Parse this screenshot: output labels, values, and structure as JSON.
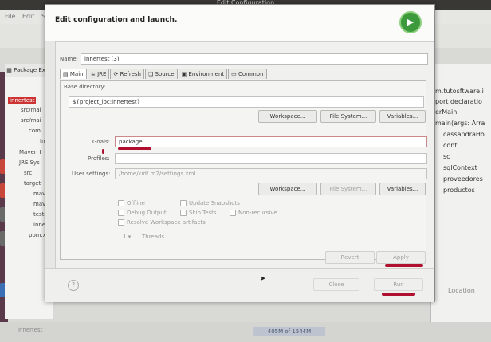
{
  "window_title": "Edit Configuration",
  "ide": {
    "menu": [
      "File",
      "Edit",
      "So"
    ],
    "package_explorer_tab": "Package Exp",
    "tree": [
      "innertest",
      "src/mai",
      "src/mai",
      "com.",
      "In",
      "Maven I",
      "JRE Sys",
      "src",
      "target",
      "mave",
      "mave",
      "test-",
      "inner",
      "pom.xn"
    ],
    "outline": [
      "m.tutosftware.i",
      "port declaratio",
      "erMain",
      "main(args: Arra",
      "cassandraHo",
      "conf",
      "sc",
      "sqlContext",
      "proveedores",
      "productos"
    ],
    "location_header": "Location",
    "status_left": "innertest",
    "heap": "405M of 1544M"
  },
  "dialog": {
    "header": "Edit configuration and launch.",
    "name_label": "Name:",
    "name_value": "innertest (3)",
    "tabs": [
      "Main",
      "JRE",
      "Refresh",
      "Source",
      "Environment",
      "Common"
    ],
    "base_dir_label": "Base directory:",
    "base_dir_value": "${project_loc:innertest}",
    "workspace_btn": "Workspace...",
    "filesystem_btn": "File System...",
    "variables_btn": "Variables...",
    "goals_label": "Goals:",
    "goals_value": "package",
    "profiles_label": "Profiles:",
    "profiles_value": "",
    "user_settings_label": "User settings:",
    "user_settings_value": "/home/kid/.m2/settings.xml",
    "checks": {
      "offline": "Offline",
      "update_snapshots": "Update Snapshots",
      "debug_output": "Debug Output",
      "skip_tests": "Skip Tests",
      "non_recursive": "Non-recursive",
      "resolve_workspace": "Resolve Workspace artifacts"
    },
    "threads_value": "1",
    "threads_label": "Threads",
    "revert": "Revert",
    "apply": "Apply",
    "help_icon": "?",
    "close": "Close",
    "run": "Run"
  },
  "colors": {
    "annotation": "#b01030",
    "run_green": "#3c9a3c"
  }
}
